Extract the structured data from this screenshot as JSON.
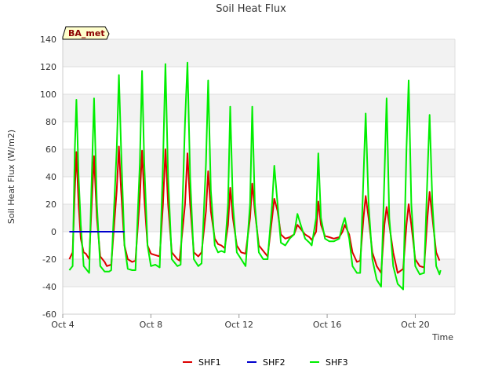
{
  "chart_data": {
    "type": "line",
    "title": "Soil Heat Flux",
    "xlabel": "Time",
    "ylabel": "Soil Heat Flux (W/m2)",
    "ylim": [
      -60,
      140
    ],
    "xlim": [
      4.0,
      21.8
    ],
    "yticks": [
      -60,
      -40,
      -20,
      0,
      20,
      40,
      60,
      80,
      100,
      120,
      140
    ],
    "xticks": [
      {
        "value": 4,
        "label": "Oct 4"
      },
      {
        "value": 8,
        "label": "Oct 8"
      },
      {
        "value": 12,
        "label": "Oct 12"
      },
      {
        "value": 16,
        "label": "Oct 16"
      },
      {
        "value": 20,
        "label": "Oct 20"
      }
    ],
    "grid": true,
    "legend_position": "bottom",
    "badge": "BA_met",
    "series": [
      {
        "name": "SHF1",
        "color": "#dd0000",
        "points": [
          [
            4.3,
            -20
          ],
          [
            4.45,
            -15
          ],
          [
            4.55,
            30
          ],
          [
            4.62,
            58
          ],
          [
            4.72,
            20
          ],
          [
            4.82,
            -5
          ],
          [
            4.95,
            -15
          ],
          [
            5.05,
            -16
          ],
          [
            5.2,
            -20
          ],
          [
            5.3,
            15
          ],
          [
            5.42,
            55
          ],
          [
            5.55,
            10
          ],
          [
            5.7,
            -18
          ],
          [
            5.9,
            -22
          ],
          [
            6.0,
            -25
          ],
          [
            6.2,
            -24
          ],
          [
            6.45,
            30
          ],
          [
            6.55,
            62
          ],
          [
            6.65,
            30
          ],
          [
            6.8,
            -10
          ],
          [
            6.95,
            -20
          ],
          [
            7.15,
            -22
          ],
          [
            7.3,
            -21
          ],
          [
            7.5,
            25
          ],
          [
            7.6,
            59
          ],
          [
            7.7,
            25
          ],
          [
            7.85,
            -10
          ],
          [
            8.0,
            -16
          ],
          [
            8.2,
            -17
          ],
          [
            8.4,
            -18
          ],
          [
            8.55,
            20
          ],
          [
            8.66,
            60
          ],
          [
            8.78,
            20
          ],
          [
            8.95,
            -15
          ],
          [
            9.2,
            -20
          ],
          [
            9.3,
            -21
          ],
          [
            9.55,
            20
          ],
          [
            9.66,
            57
          ],
          [
            9.78,
            20
          ],
          [
            9.95,
            -15
          ],
          [
            10.15,
            -18
          ],
          [
            10.3,
            -15
          ],
          [
            10.5,
            15
          ],
          [
            10.6,
            44
          ],
          [
            10.72,
            15
          ],
          [
            10.9,
            -5
          ],
          [
            11.05,
            -9
          ],
          [
            11.2,
            -10
          ],
          [
            11.35,
            -12
          ],
          [
            11.5,
            5
          ],
          [
            11.6,
            32
          ],
          [
            11.72,
            10
          ],
          [
            11.9,
            -10
          ],
          [
            12.1,
            -15
          ],
          [
            12.3,
            -16
          ],
          [
            12.5,
            10
          ],
          [
            12.6,
            35
          ],
          [
            12.72,
            15
          ],
          [
            12.9,
            -10
          ],
          [
            13.1,
            -14
          ],
          [
            13.3,
            -18
          ],
          [
            13.5,
            10
          ],
          [
            13.6,
            24
          ],
          [
            13.75,
            15
          ],
          [
            13.9,
            -2
          ],
          [
            14.1,
            -5
          ],
          [
            14.3,
            -4
          ],
          [
            14.5,
            -2
          ],
          [
            14.65,
            5
          ],
          [
            14.8,
            2
          ],
          [
            15.0,
            -2
          ],
          [
            15.2,
            -4
          ],
          [
            15.3,
            -6
          ],
          [
            15.5,
            0
          ],
          [
            15.6,
            22
          ],
          [
            15.72,
            5
          ],
          [
            15.9,
            -3
          ],
          [
            16.1,
            -4
          ],
          [
            16.3,
            -5
          ],
          [
            16.55,
            -4
          ],
          [
            16.7,
            0
          ],
          [
            16.8,
            5
          ],
          [
            17.0,
            -2
          ],
          [
            17.15,
            -15
          ],
          [
            17.35,
            -22
          ],
          [
            17.5,
            -21
          ],
          [
            17.65,
            10
          ],
          [
            17.75,
            26
          ],
          [
            17.88,
            10
          ],
          [
            18.05,
            -15
          ],
          [
            18.25,
            -25
          ],
          [
            18.45,
            -30
          ],
          [
            18.6,
            5
          ],
          [
            18.7,
            18
          ],
          [
            18.82,
            5
          ],
          [
            19.0,
            -15
          ],
          [
            19.2,
            -30
          ],
          [
            19.45,
            -27
          ],
          [
            19.6,
            5
          ],
          [
            19.7,
            20
          ],
          [
            19.82,
            5
          ],
          [
            20.0,
            -20
          ],
          [
            20.2,
            -25
          ],
          [
            20.4,
            -26
          ],
          [
            20.55,
            10
          ],
          [
            20.65,
            29
          ],
          [
            20.78,
            10
          ],
          [
            20.95,
            -15
          ],
          [
            21.1,
            -21
          ]
        ]
      },
      {
        "name": "SHF2",
        "color": "#0000cc",
        "points": [
          [
            4.3,
            0
          ],
          [
            6.8,
            0
          ]
        ]
      },
      {
        "name": "SHF3",
        "color": "#00ee00",
        "points": [
          [
            4.3,
            -28
          ],
          [
            4.45,
            -25
          ],
          [
            4.55,
            60
          ],
          [
            4.62,
            96
          ],
          [
            4.66,
            75
          ],
          [
            4.72,
            40
          ],
          [
            4.82,
            5
          ],
          [
            4.95,
            -25
          ],
          [
            5.1,
            -28
          ],
          [
            5.2,
            -30
          ],
          [
            5.3,
            30
          ],
          [
            5.42,
            97
          ],
          [
            5.55,
            20
          ],
          [
            5.7,
            -25
          ],
          [
            5.9,
            -29
          ],
          [
            6.1,
            -29
          ],
          [
            6.2,
            -28
          ],
          [
            6.45,
            60
          ],
          [
            6.55,
            114
          ],
          [
            6.65,
            60
          ],
          [
            6.8,
            -10
          ],
          [
            6.95,
            -27
          ],
          [
            7.15,
            -28
          ],
          [
            7.3,
            -28
          ],
          [
            7.5,
            50
          ],
          [
            7.6,
            117
          ],
          [
            7.7,
            50
          ],
          [
            7.85,
            -10
          ],
          [
            8.0,
            -25
          ],
          [
            8.2,
            -24
          ],
          [
            8.4,
            -26
          ],
          [
            8.55,
            50
          ],
          [
            8.66,
            122
          ],
          [
            8.78,
            40
          ],
          [
            8.95,
            -20
          ],
          [
            9.2,
            -25
          ],
          [
            9.35,
            -24
          ],
          [
            9.55,
            80
          ],
          [
            9.66,
            123
          ],
          [
            9.78,
            40
          ],
          [
            9.95,
            -20
          ],
          [
            10.15,
            -25
          ],
          [
            10.3,
            -23
          ],
          [
            10.5,
            50
          ],
          [
            10.6,
            110
          ],
          [
            10.72,
            30
          ],
          [
            10.9,
            -10
          ],
          [
            11.05,
            -15
          ],
          [
            11.2,
            -14
          ],
          [
            11.35,
            -15
          ],
          [
            11.5,
            20
          ],
          [
            11.6,
            91
          ],
          [
            11.72,
            20
          ],
          [
            11.9,
            -15
          ],
          [
            12.1,
            -20
          ],
          [
            12.3,
            -25
          ],
          [
            12.5,
            20
          ],
          [
            12.6,
            91
          ],
          [
            12.72,
            20
          ],
          [
            12.9,
            -15
          ],
          [
            13.1,
            -20
          ],
          [
            13.3,
            -20
          ],
          [
            13.5,
            20
          ],
          [
            13.6,
            48
          ],
          [
            13.75,
            20
          ],
          [
            13.9,
            -8
          ],
          [
            14.1,
            -10
          ],
          [
            14.3,
            -5
          ],
          [
            14.5,
            -2
          ],
          [
            14.65,
            13
          ],
          [
            14.8,
            5
          ],
          [
            15.0,
            -5
          ],
          [
            15.2,
            -8
          ],
          [
            15.3,
            -10
          ],
          [
            15.5,
            10
          ],
          [
            15.6,
            57
          ],
          [
            15.72,
            10
          ],
          [
            15.9,
            -5
          ],
          [
            16.1,
            -7
          ],
          [
            16.3,
            -7
          ],
          [
            16.55,
            -5
          ],
          [
            16.7,
            5
          ],
          [
            16.8,
            10
          ],
          [
            17.0,
            -5
          ],
          [
            17.15,
            -25
          ],
          [
            17.35,
            -30
          ],
          [
            17.5,
            -30
          ],
          [
            17.65,
            40
          ],
          [
            17.75,
            86
          ],
          [
            17.88,
            20
          ],
          [
            18.05,
            -20
          ],
          [
            18.25,
            -35
          ],
          [
            18.45,
            -40
          ],
          [
            18.6,
            40
          ],
          [
            18.7,
            97
          ],
          [
            18.82,
            10
          ],
          [
            19.0,
            -25
          ],
          [
            19.2,
            -38
          ],
          [
            19.45,
            -42
          ],
          [
            19.6,
            60
          ],
          [
            19.7,
            110
          ],
          [
            19.82,
            20
          ],
          [
            20.0,
            -25
          ],
          [
            20.2,
            -31
          ],
          [
            20.4,
            -30
          ],
          [
            20.55,
            40
          ],
          [
            20.65,
            85
          ],
          [
            20.78,
            20
          ],
          [
            20.95,
            -25
          ],
          [
            21.1,
            -31
          ],
          [
            21.15,
            -28
          ]
        ]
      }
    ]
  }
}
